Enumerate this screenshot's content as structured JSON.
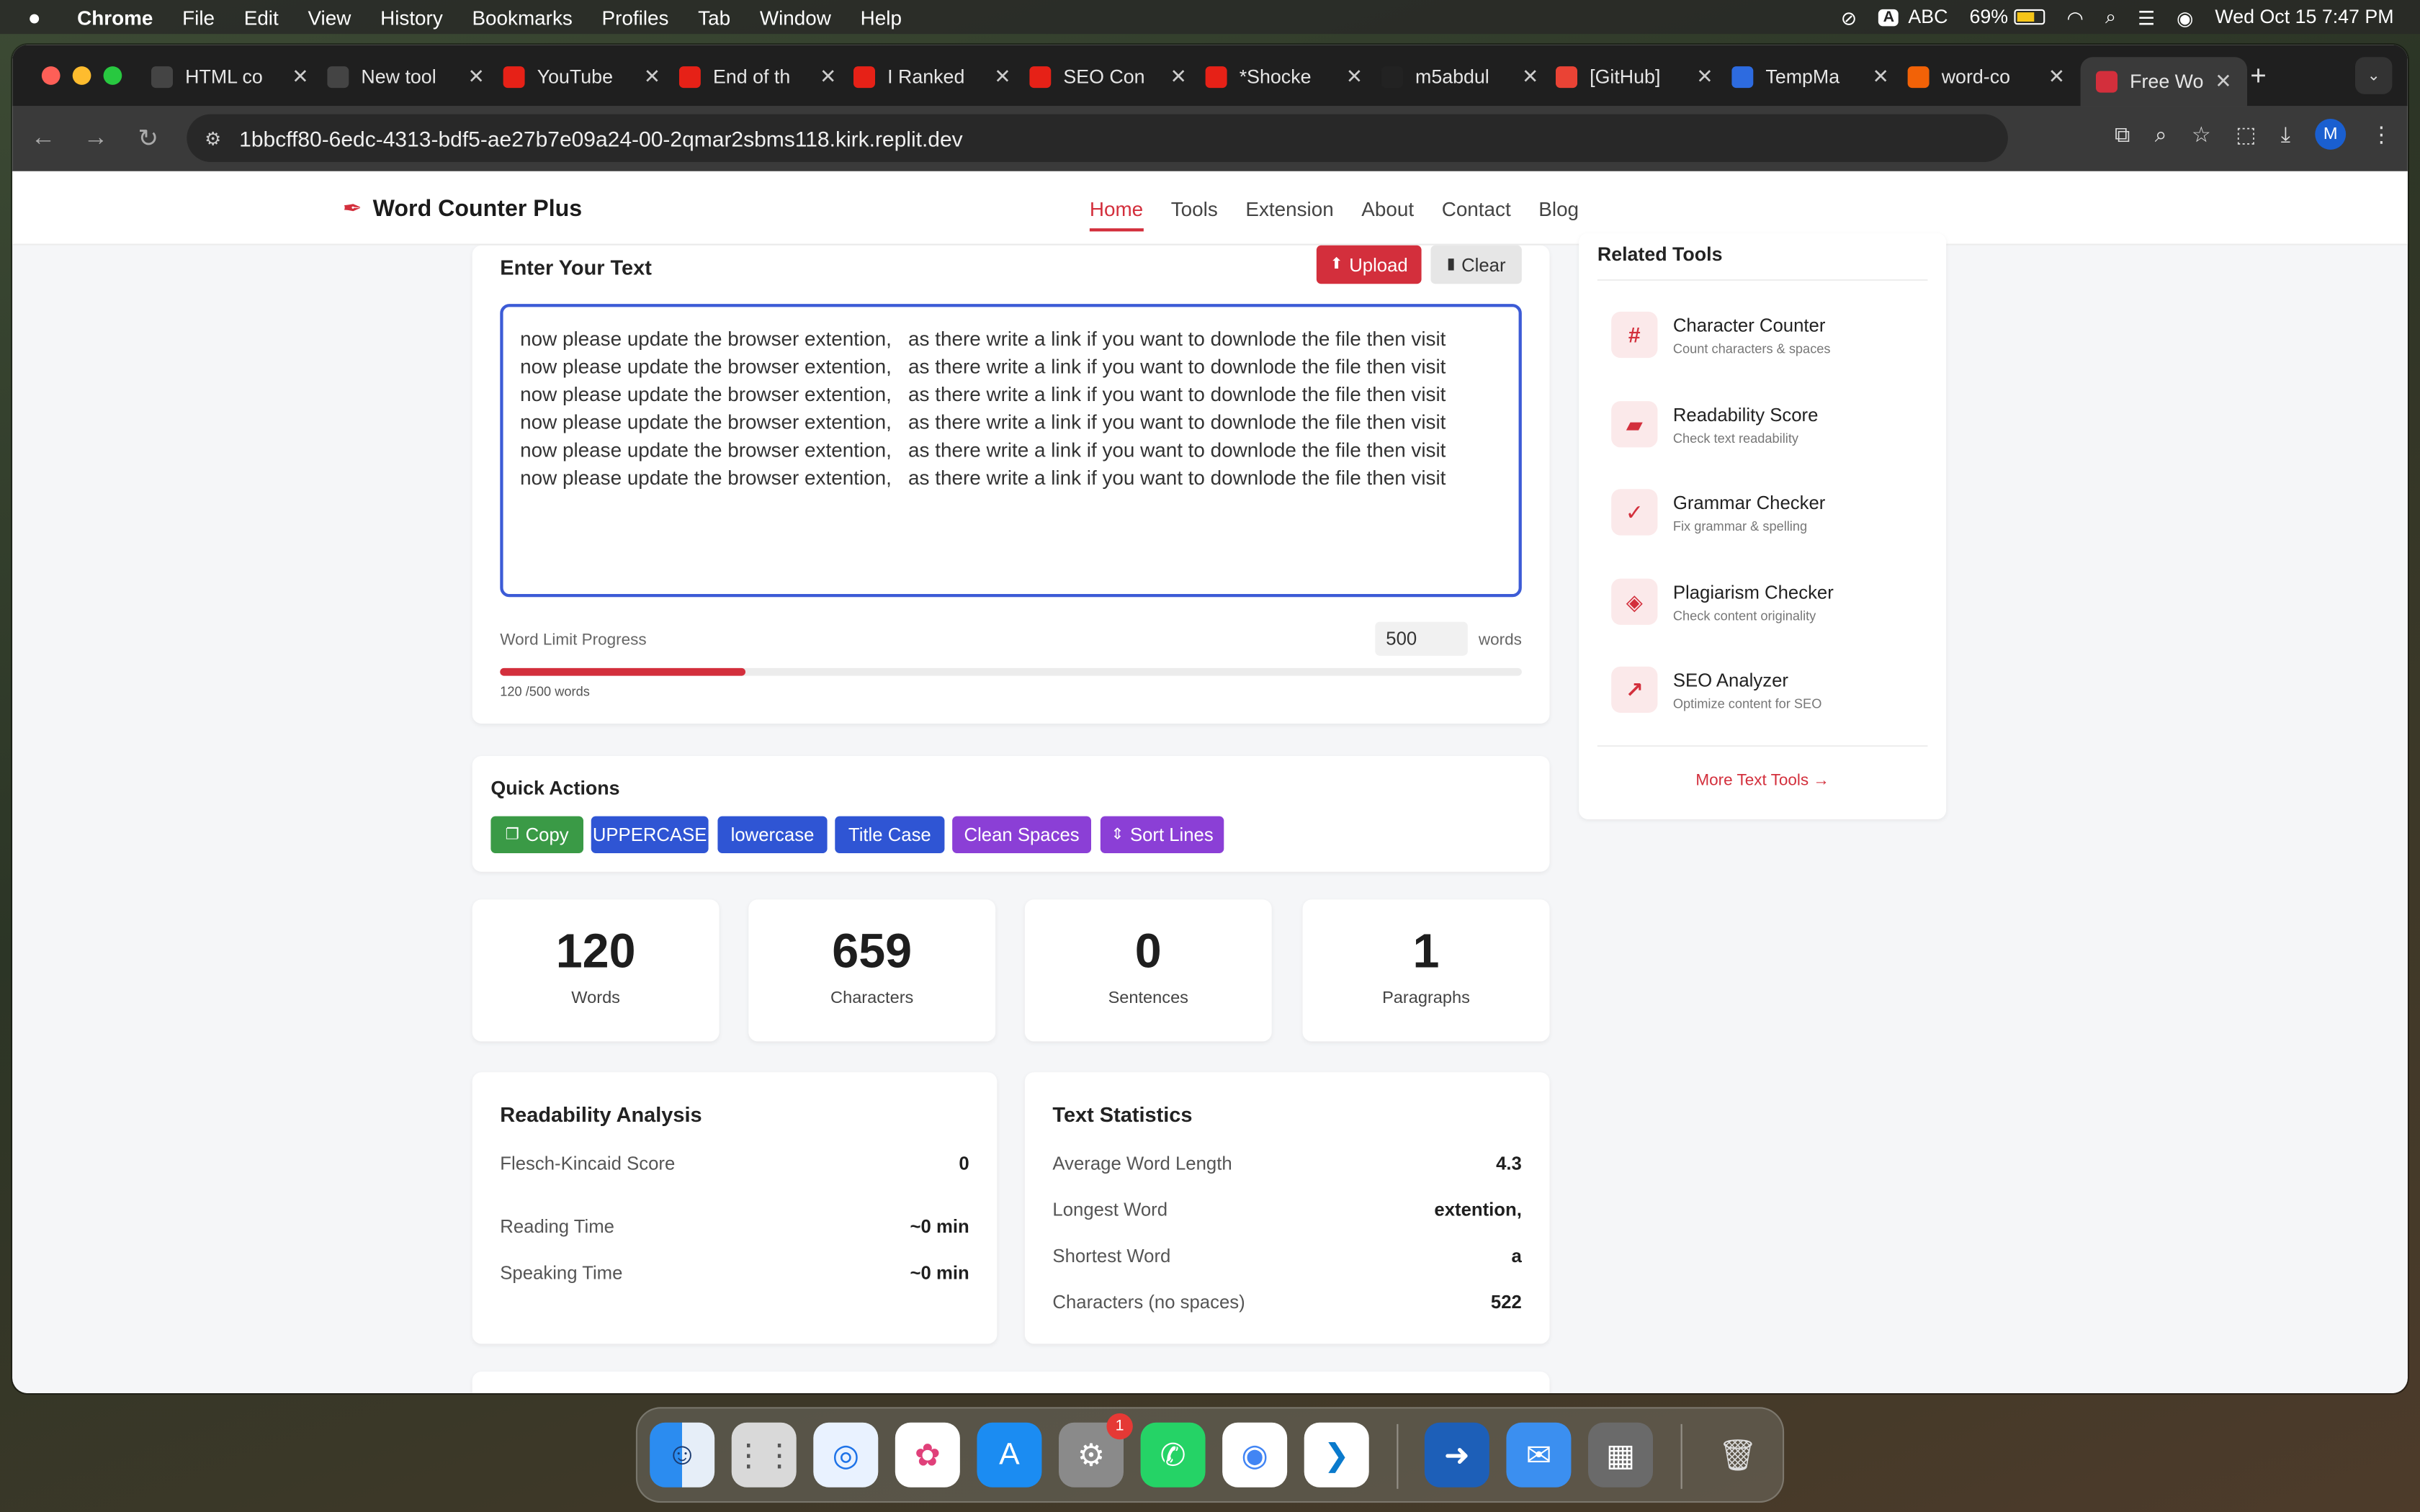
{
  "menubar": {
    "app": "Chrome",
    "items": [
      "File",
      "Edit",
      "View",
      "History",
      "Bookmarks",
      "Profiles",
      "Tab",
      "Window",
      "Help"
    ],
    "input_source": "ABC",
    "input_badge": "A",
    "battery": "69%",
    "datetime": "Wed Oct 15  7:47 PM"
  },
  "tabs": [
    {
      "title": "HTML co",
      "favicon": "openai-icon",
      "color": "#444"
    },
    {
      "title": "New tool",
      "favicon": "openai-icon",
      "color": "#444"
    },
    {
      "title": "YouTube",
      "favicon": "youtube-icon",
      "color": "#e62117"
    },
    {
      "title": "End of th",
      "favicon": "youtube-icon",
      "color": "#e62117"
    },
    {
      "title": "I Ranked",
      "favicon": "youtube-icon",
      "color": "#e62117"
    },
    {
      "title": "SEO Con",
      "favicon": "youtube-icon",
      "color": "#e62117"
    },
    {
      "title": "*Shocke",
      "favicon": "youtube-icon",
      "color": "#e62117"
    },
    {
      "title": "m5abdul",
      "favicon": "github-icon",
      "color": "#222"
    },
    {
      "title": "[GitHub]",
      "favicon": "gmail-icon",
      "color": "#ea4335"
    },
    {
      "title": "TempMa",
      "favicon": "mail-icon",
      "color": "#2d6be0"
    },
    {
      "title": "word-co",
      "favicon": "replit-icon",
      "color": "#f26207"
    },
    {
      "title": "Free Wo",
      "favicon": "pen-icon",
      "color": "#d32f3c",
      "active": true
    }
  ],
  "url": "1bbcff80-6edc-4313-bdf5-ae27b7e09a24-00-2qmar2sbms118.kirk.replit.dev",
  "profile_initial": "M",
  "site": {
    "name": "Word Counter Plus",
    "nav": [
      "Home",
      "Tools",
      "Extension",
      "About",
      "Contact",
      "Blog"
    ]
  },
  "editor": {
    "title": "Enter Your Text",
    "upload": "Upload",
    "clear": "Clear",
    "text": "now please update the browser extention,   as there write a link if you want to downlode the file then visit\nnow please update the browser extention,   as there write a link if you want to downlode the file then visit\nnow please update the browser extention,   as there write a link if you want to downlode the file then visit\nnow please update the browser extention,   as there write a link if you want to downlode the file then visit\nnow please update the browser extention,   as there write a link if you want to downlode the file then visit\nnow please update the browser extention,   as there write a link if you want to downlode the file then visit",
    "limit_label": "Word Limit Progress",
    "limit_value": "500",
    "limit_unit": "words",
    "progress_text": "120 /500 words",
    "progress_fraction": 0.24
  },
  "quick_actions": {
    "title": "Quick Actions",
    "buttons": [
      "Copy",
      "UPPERCASE",
      "lowercase",
      "Title Case",
      "Clean Spaces",
      "Sort Lines"
    ]
  },
  "stats": [
    {
      "value": "120",
      "label": "Words"
    },
    {
      "value": "659",
      "label": "Characters"
    },
    {
      "value": "0",
      "label": "Sentences"
    },
    {
      "value": "1",
      "label": "Paragraphs"
    }
  ],
  "readability": {
    "title": "Readability Analysis",
    "rows": [
      {
        "label": "Flesch-Kincaid Score",
        "value": "0"
      },
      {
        "label": "Reading Time",
        "value": "~0 min"
      },
      {
        "label": "Speaking Time",
        "value": "~0 min"
      }
    ]
  },
  "text_stats": {
    "title": "Text Statistics",
    "rows": [
      {
        "label": "Average Word Length",
        "value": "4.3"
      },
      {
        "label": "Longest Word",
        "value": "extention,"
      },
      {
        "label": "Shortest Word",
        "value": "a"
      },
      {
        "label": "Characters (no spaces)",
        "value": "522"
      }
    ]
  },
  "related": {
    "title": "Related Tools",
    "more": "More Text Tools →",
    "tools": [
      {
        "name": "Character Counter",
        "desc": "Count characters & spaces",
        "icon": "#"
      },
      {
        "name": "Readability Score",
        "desc": "Check text readability",
        "icon": "▰"
      },
      {
        "name": "Grammar Checker",
        "desc": "Fix grammar & spelling",
        "icon": "✓"
      },
      {
        "name": "Plagiarism Checker",
        "desc": "Check content originality",
        "icon": "◈"
      },
      {
        "name": "SEO Analyzer",
        "desc": "Optimize content for SEO",
        "icon": "↗"
      }
    ]
  },
  "dock": {
    "notification_badge": "1",
    "apps": [
      "finder",
      "launchpad",
      "safari",
      "photos",
      "app-store",
      "system-settings",
      "whatsapp",
      "chrome",
      "vscode",
      "migration",
      "mail",
      "calculator",
      "trash"
    ]
  },
  "colors": {
    "brand": "#d32f3c",
    "green": "#3a9a46",
    "blue": "#2f55d4",
    "purple": "#8b3fd6"
  }
}
